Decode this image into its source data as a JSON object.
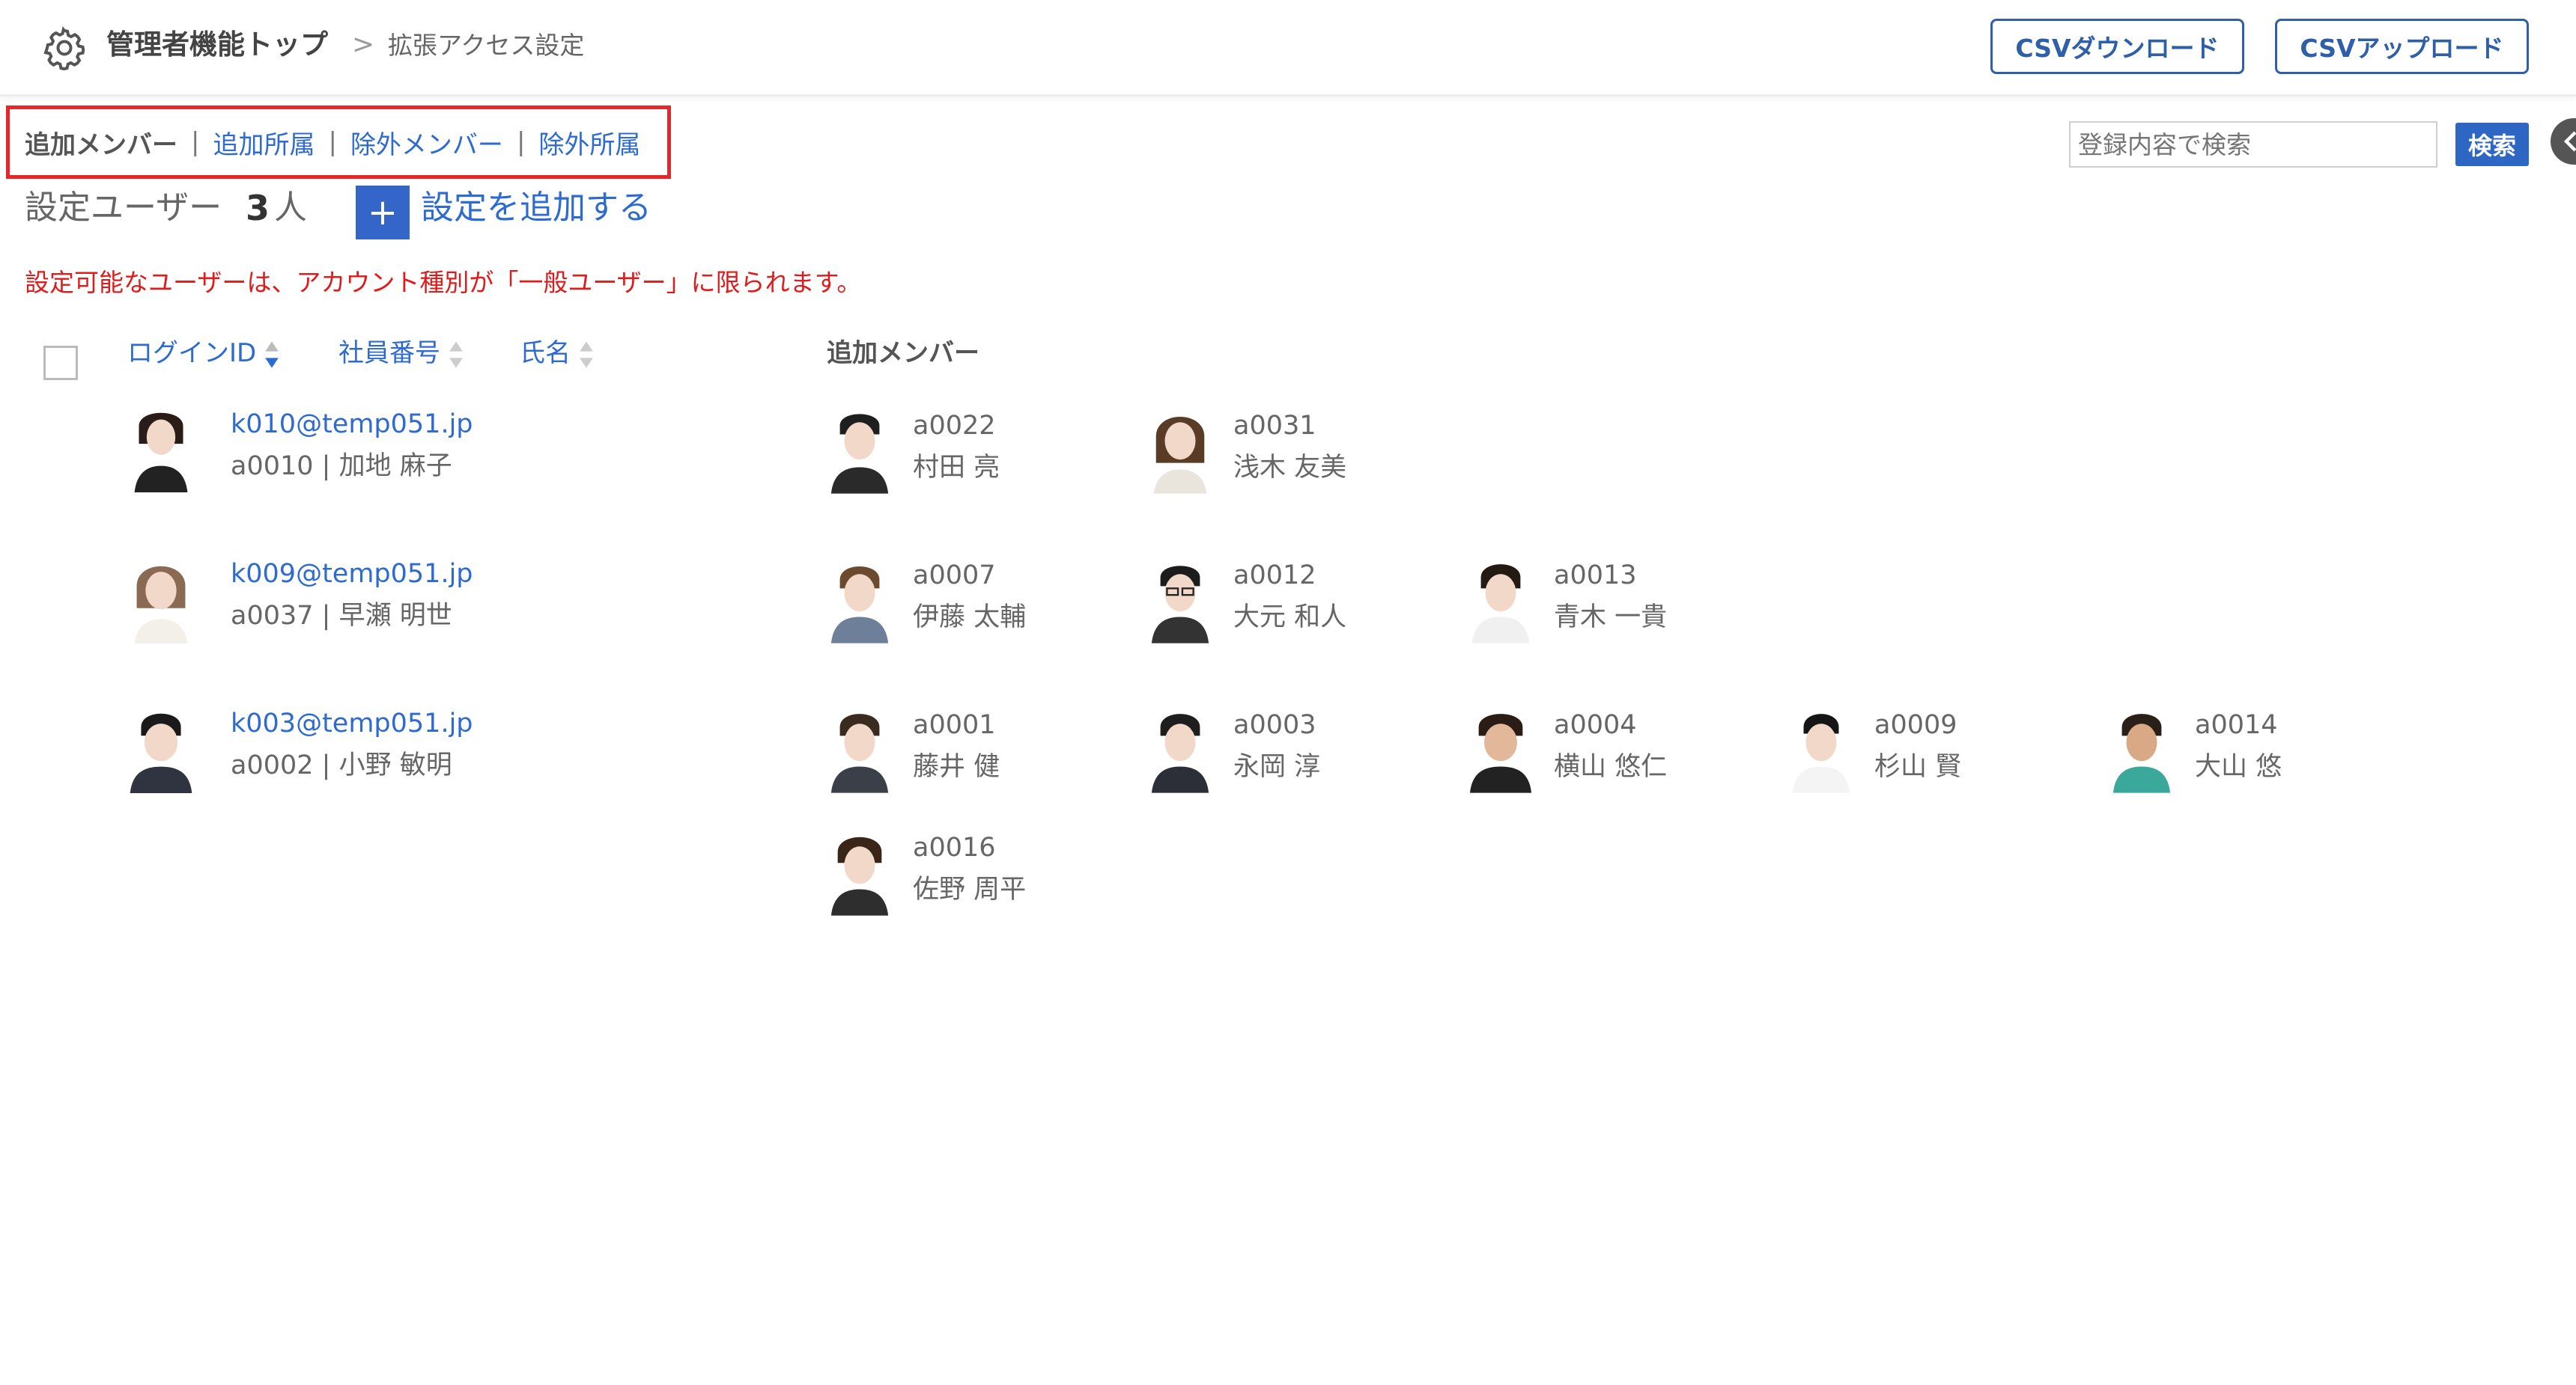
{
  "header": {
    "breadcrumb_root": "管理者機能トップ",
    "breadcrumb_separator": ">",
    "breadcrumb_current": "拡張アクセス設定",
    "csv_download_label": "CSVダウンロード",
    "csv_upload_label": "CSVアップロード"
  },
  "tabs": {
    "items": [
      {
        "label": "追加メンバー",
        "active": true
      },
      {
        "label": "追加所属",
        "active": false
      },
      {
        "label": "除外メンバー",
        "active": false
      },
      {
        "label": "除外所属",
        "active": false
      }
    ],
    "separator": "|"
  },
  "search": {
    "placeholder": "登録内容で検索",
    "button_label": "検索"
  },
  "summary": {
    "label": "設定ユーザー",
    "count": "3",
    "unit": "人",
    "add_button_symbol": "+",
    "add_link_label": "設定を追加する"
  },
  "notice": "設定可能なユーザーは、アカウント種別が「一般ユーザー」に限られます。",
  "table": {
    "columns": {
      "login_id": "ログインID",
      "employee_no": "社員番号",
      "name": "氏名",
      "members": "追加メンバー"
    },
    "rows": [
      {
        "email": "k010@temp051.jp",
        "meta": "a0010 | 加地 麻子",
        "members": [
          {
            "code": "a0022",
            "name": "村田 亮"
          },
          {
            "code": "a0031",
            "name": "浅木 友美"
          }
        ]
      },
      {
        "email": "k009@temp051.jp",
        "meta": "a0037 | 早瀬 明世",
        "members": [
          {
            "code": "a0007",
            "name": "伊藤 太輔"
          },
          {
            "code": "a0012",
            "name": "大元 和人"
          },
          {
            "code": "a0013",
            "name": "青木 一貴"
          }
        ]
      },
      {
        "email": "k003@temp051.jp",
        "meta": "a0002 | 小野 敏明",
        "members": [
          {
            "code": "a0001",
            "name": "藤井 健"
          },
          {
            "code": "a0003",
            "name": "永岡 淳"
          },
          {
            "code": "a0004",
            "name": "横山 悠仁"
          },
          {
            "code": "a0009",
            "name": "杉山 賢"
          },
          {
            "code": "a0014",
            "name": "大山 悠"
          },
          {
            "code": "a0016",
            "name": "佐野 周平"
          }
        ]
      }
    ]
  },
  "colors": {
    "accent": "#2e6bd0",
    "highlight_box": "#e5262b",
    "notice": "#e01b1b"
  },
  "icons": {
    "breadcrumb": "gear-icon",
    "sort_active": "sort-desc-icon",
    "sort_inactive": "sort-icon",
    "side_handle": "chevron-left-icon"
  }
}
